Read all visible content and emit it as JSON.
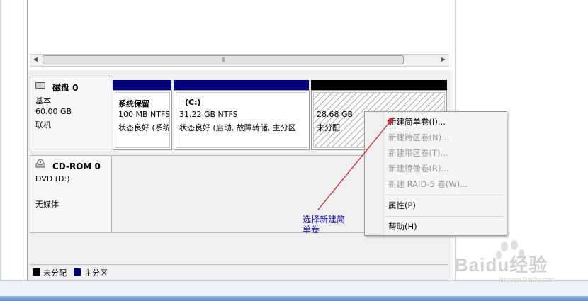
{
  "disks": [
    {
      "name": "磁盘 0",
      "type": "基本",
      "size": "60.00 GB",
      "status": "联机",
      "partitions": [
        {
          "name": "系统保留",
          "size": "100 MB NTFS",
          "status": "状态良好 (系统",
          "color": "#000080"
        },
        {
          "name": "(C:)",
          "size": "31.22 GB NTFS",
          "status": "状态良好 (启动, 故障转储, 主分区",
          "color": "#000080"
        },
        {
          "name": "",
          "size": "28.68 GB",
          "status": "未分配",
          "color": "#000000"
        }
      ]
    },
    {
      "name": "CD-ROM 0",
      "type": "DVD (D:)",
      "status": "无媒体"
    }
  ],
  "legend": [
    {
      "label": "未分配",
      "color": "#000000"
    },
    {
      "label": "主分区",
      "color": "#000080"
    }
  ],
  "context_menu": {
    "items": [
      {
        "label": "新建简单卷(I)...",
        "enabled": true
      },
      {
        "label": "新建跨区卷(N)...",
        "enabled": false
      },
      {
        "label": "新建带区卷(T)...",
        "enabled": false
      },
      {
        "label": "新建镜像卷(R)...",
        "enabled": false
      },
      {
        "label": "新建 RAID-5 卷(W)...",
        "enabled": false
      },
      {
        "label": "属性(P)",
        "enabled": true
      },
      {
        "label": "帮助(H)",
        "enabled": true
      }
    ]
  },
  "annotation": {
    "line1": "选择新建简",
    "line2": "单卷",
    "color": "#1414b4",
    "arrow_color": "#e02020"
  },
  "watermark": {
    "brand": "Baidu经验",
    "url": "jingyan.baidu.com"
  },
  "icons": {
    "disk": "hard-disk-icon",
    "cdrom": "cdrom-icon",
    "scroll_left": "scroll-left-arrow-icon",
    "scroll_right": "scroll-right-arrow-icon"
  }
}
